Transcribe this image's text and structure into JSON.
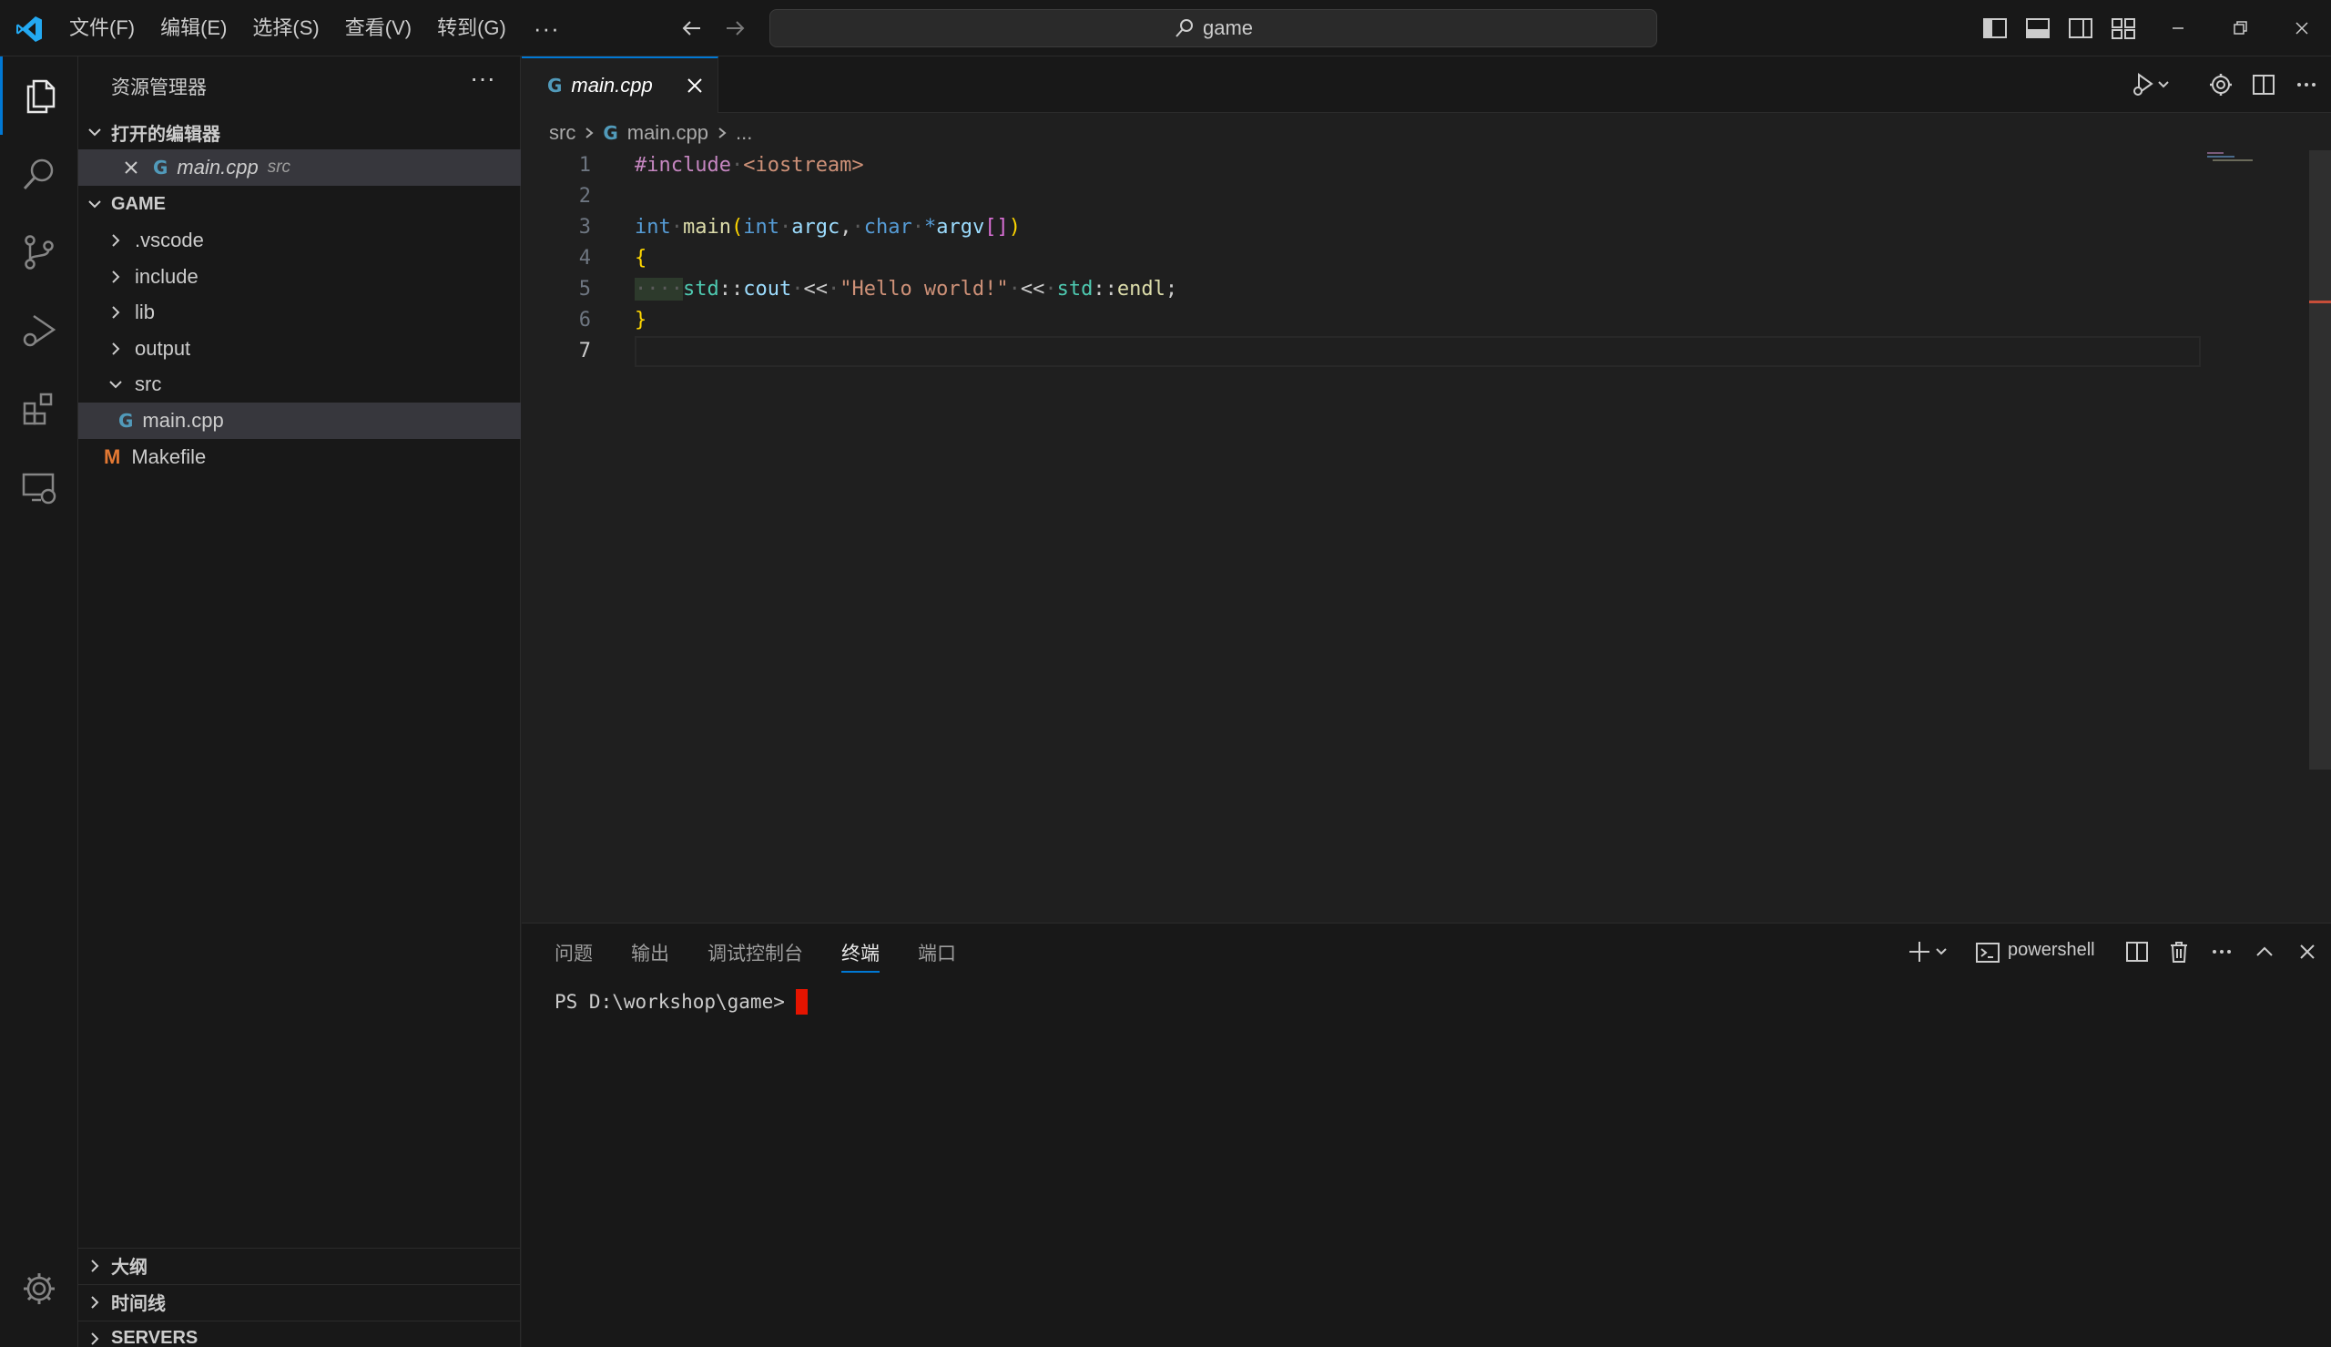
{
  "menu": [
    "文件(F)",
    "编辑(E)",
    "选择(S)",
    "查看(V)",
    "转到(G)"
  ],
  "menu_more": "···",
  "search": {
    "text": "game"
  },
  "sidebar": {
    "title": "资源管理器",
    "more": "···",
    "open_editors": {
      "header": "打开的编辑器",
      "items": [
        {
          "name": "main.cpp",
          "desc": "src"
        }
      ]
    },
    "workspace": {
      "header": "GAME",
      "items": [
        {
          "label": ".vscode"
        },
        {
          "label": "include"
        },
        {
          "label": "lib"
        },
        {
          "label": "output"
        },
        {
          "label": "src"
        },
        {
          "label": "main.cpp"
        },
        {
          "label": "Makefile"
        }
      ]
    },
    "bottom_sections": [
      "大纲",
      "时间线",
      "SERVERS"
    ]
  },
  "editor": {
    "tab": {
      "label": "main.cpp"
    },
    "breadcrumb": [
      "src",
      "main.cpp",
      "..."
    ],
    "line_numbers": [
      "1",
      "2",
      "3",
      "4",
      "5",
      "6",
      "7"
    ],
    "code": {
      "l1_directive": "#include",
      "l1_header": "<iostream>",
      "l3_int": "int",
      "l3_main": "main",
      "l3_int2": "int",
      "l3_argc": "argc",
      "l3_char": "char",
      "l3_star": "*",
      "l3_argv": "argv",
      "l4_brace": "{",
      "l5_ws": "····",
      "l5_std1": "std",
      "l5_cout": "cout",
      "l5_op1": "<<",
      "l5_str": "\"Hello world!\"",
      "l5_op2": "<<",
      "l5_std2": "std",
      "l5_endl": "endl",
      "l6_brace": "}"
    }
  },
  "panel": {
    "tabs": [
      "问题",
      "输出",
      "调试控制台",
      "终端",
      "端口"
    ],
    "active_tab": "终端",
    "shell": "powershell",
    "terminal_prompt": "PS D:\\workshop\\game>"
  },
  "colors": {
    "accent": "#0078d4",
    "cursor": "#e51400",
    "cpp_icon": "#519aba",
    "makefile_icon": "#e37933"
  }
}
